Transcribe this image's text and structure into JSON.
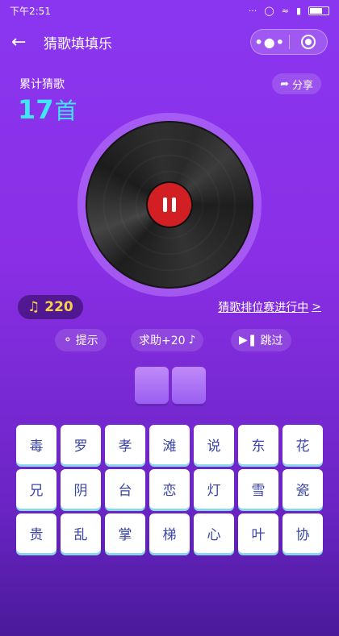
{
  "status_bar": {
    "time": "下午2:51",
    "signal_text": "···"
  },
  "nav": {
    "back_icon": "back-arrow-icon",
    "title": "猜歌填填乐",
    "more_label": "•●•"
  },
  "stats": {
    "label": "累计猜歌",
    "count": "17",
    "unit": "首"
  },
  "share": {
    "label": "分享",
    "icon": "share-icon"
  },
  "player": {
    "state": "playing",
    "pause_icon": "pause-icon"
  },
  "coins": {
    "value": "220",
    "icon": "music-note-icon",
    "color": "#f7d247"
  },
  "ranking": {
    "label": "猜歌排位赛进行中",
    "arrow": ">"
  },
  "actions": {
    "hint_label": "提示",
    "help_label": "求助+20",
    "skip_label": "跳过"
  },
  "answer_slots": 2,
  "keyboard": {
    "keys": [
      "毒",
      "罗",
      "孝",
      "滩",
      "说",
      "东",
      "花",
      "兄",
      "阴",
      "台",
      "恋",
      "灯",
      "雪",
      "瓷",
      "贵",
      "乱",
      "掌",
      "梯",
      "心",
      "叶",
      "协"
    ]
  },
  "colors": {
    "accent_cyan": "#3fe6f5",
    "record_red": "#d11f24",
    "key_text": "#3b44a8"
  }
}
